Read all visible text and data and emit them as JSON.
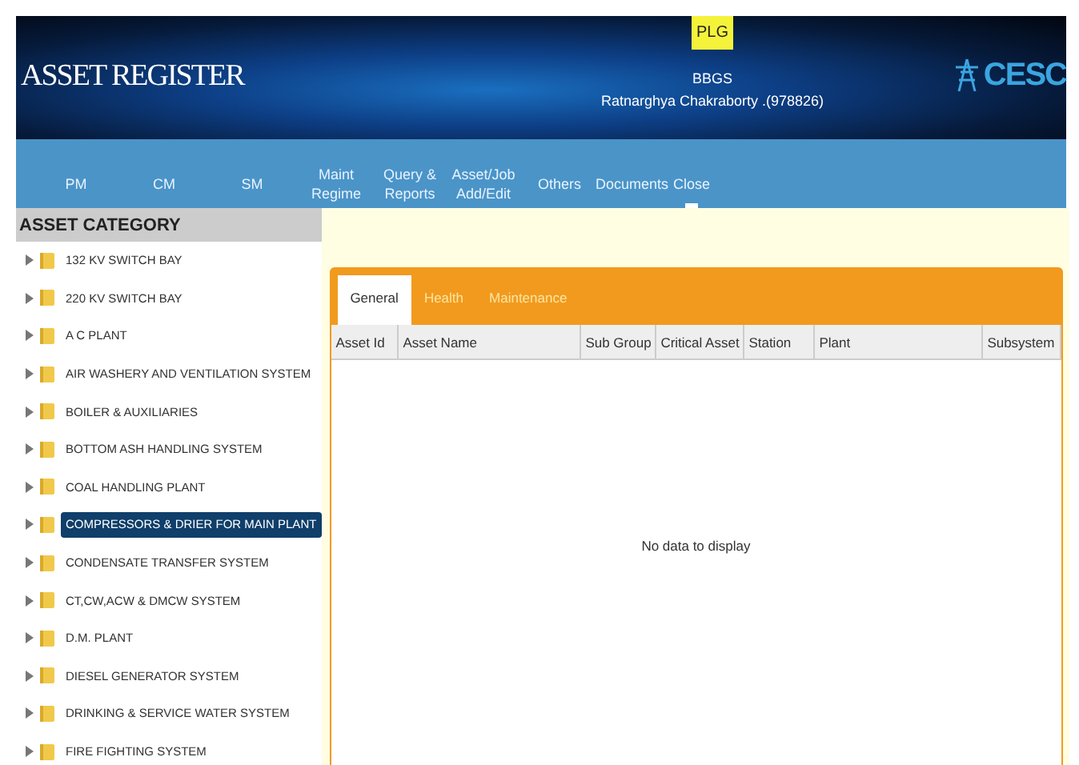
{
  "header": {
    "title": "ASSET REGISTER",
    "badge": "PLG",
    "station": "BBGS",
    "user": "Ratnarghya Chakraborty .(978826)",
    "logo": "CESC"
  },
  "nav": [
    {
      "label": "PM",
      "selected": false
    },
    {
      "label": "CM",
      "selected": false
    },
    {
      "label": "SM",
      "selected": false
    },
    {
      "label": "Maint\nRegime",
      "selected": false
    },
    {
      "label": "Query &\nReports",
      "selected": false
    },
    {
      "label": "Asset/Job\nAdd/Edit",
      "selected": false
    },
    {
      "label": "Others",
      "selected": false
    },
    {
      "label": "Documents",
      "selected": false
    },
    {
      "label": "Close",
      "selected": true
    }
  ],
  "sidebar": {
    "title": "ASSET CATEGORY",
    "items": [
      {
        "label": "132 KV SWITCH BAY",
        "selected": false
      },
      {
        "label": "220 KV SWITCH BAY",
        "selected": false
      },
      {
        "label": "A C PLANT",
        "selected": false
      },
      {
        "label": "AIR WASHERY AND VENTILATION SYSTEM",
        "selected": false
      },
      {
        "label": "BOILER & AUXILIARIES",
        "selected": false
      },
      {
        "label": "BOTTOM ASH HANDLING SYSTEM",
        "selected": false
      },
      {
        "label": "COAL HANDLING PLANT",
        "selected": false
      },
      {
        "label": "COMPRESSORS & DRIER FOR MAIN PLANT",
        "selected": true
      },
      {
        "label": "CONDENSATE TRANSFER SYSTEM",
        "selected": false
      },
      {
        "label": "CT,CW,ACW & DMCW SYSTEM",
        "selected": false
      },
      {
        "label": "D.M. PLANT",
        "selected": false
      },
      {
        "label": "DIESEL GENERATOR SYSTEM",
        "selected": false
      },
      {
        "label": "DRINKING & SERVICE WATER SYSTEM",
        "selected": false
      },
      {
        "label": "FIRE FIGHTING SYSTEM",
        "selected": false
      }
    ]
  },
  "tabs": [
    {
      "label": "General",
      "selected": true
    },
    {
      "label": "Health",
      "selected": false
    },
    {
      "label": "Maintenance",
      "selected": false
    }
  ],
  "table": {
    "columns": [
      "Asset Id",
      "Asset Name",
      "Sub Group",
      "Critical Asset",
      "Station",
      "Plant",
      "Subsystem"
    ],
    "empty_text": "No data to display"
  }
}
